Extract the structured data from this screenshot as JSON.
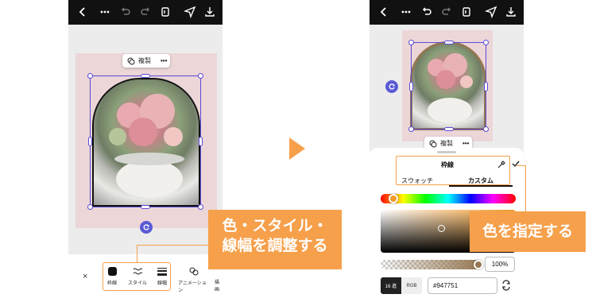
{
  "left_screen": {
    "duplicate_label": "複製",
    "toolbar": {
      "close_label": "×",
      "items": [
        "枠線",
        "スタイル",
        "線幅",
        "アニメーション",
        "描画"
      ]
    }
  },
  "left_callout": {
    "line1": "色・スタイル・",
    "line2": "線幅を調整する"
  },
  "right_screen": {
    "duplicate_label": "複製",
    "panel": {
      "title": "枠線",
      "tabs": [
        "スウォッチ",
        "カスタム"
      ],
      "opacity_value": "100%",
      "mode_hex": "16 進",
      "mode_rgb": "RGB",
      "hex_value": "#947751"
    }
  },
  "right_callout": {
    "text": "色を指定する"
  },
  "colors": {
    "accent_orange": "#f6a04b",
    "selection_purple": "#5b4bd6",
    "selected_color": "#947751"
  }
}
